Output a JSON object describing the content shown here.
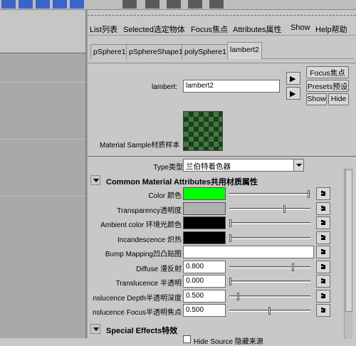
{
  "menubar": {
    "items": [
      "List列表",
      "Selected选定物体",
      "Focus焦点",
      "Attributes属性",
      "Show",
      "Help帮助"
    ]
  },
  "tabs": [
    "pSphere1",
    "pSphereShape1",
    "polySphere1",
    "lambert2"
  ],
  "header": {
    "name_label": "lambert:",
    "name_value": "lambert2",
    "focus_button": "Focus焦点",
    "presets_button": "Presets预设",
    "show_button": "Show",
    "hide_button": "Hide",
    "sample_label": "Material Sample材质样本"
  },
  "type_row": {
    "label": "Type类型",
    "value": "兰伯特着色器"
  },
  "sections": {
    "common": "Common Material Attributes共用材质属性",
    "special": "Special Effects特效"
  },
  "attributes": [
    {
      "label": "Color 颜色",
      "kind": "color",
      "color": "#00ff00",
      "slider": 1.0
    },
    {
      "label": "Transparency透明度",
      "kind": "color",
      "color": "#b0b0b0",
      "slider": 0.69
    },
    {
      "label": "Ambient color 环境光颜色",
      "kind": "color",
      "color": "#000000",
      "slider": 0.0
    },
    {
      "label": "Incandescence 炽热",
      "kind": "color",
      "color": "#000000",
      "slider": 0.0
    },
    {
      "label": "Bump Mapping凹凸贴图",
      "kind": "bump",
      "value": ""
    },
    {
      "label": "Diffuse 漫反射",
      "kind": "value",
      "value": "0.800",
      "slider": 0.8
    },
    {
      "label": "Translucence 半透明",
      "kind": "value",
      "value": "0.000",
      "slider": 0.0
    },
    {
      "label": "nslucence Depth半透明深度",
      "kind": "value",
      "value": "0.500",
      "slider": 0.1
    },
    {
      "label": "nslucence Focus半透明焦点",
      "kind": "value",
      "value": "0.500",
      "slider": 0.5
    }
  ],
  "special": {
    "hide_source_label": "Hide Source 隐藏来源"
  }
}
